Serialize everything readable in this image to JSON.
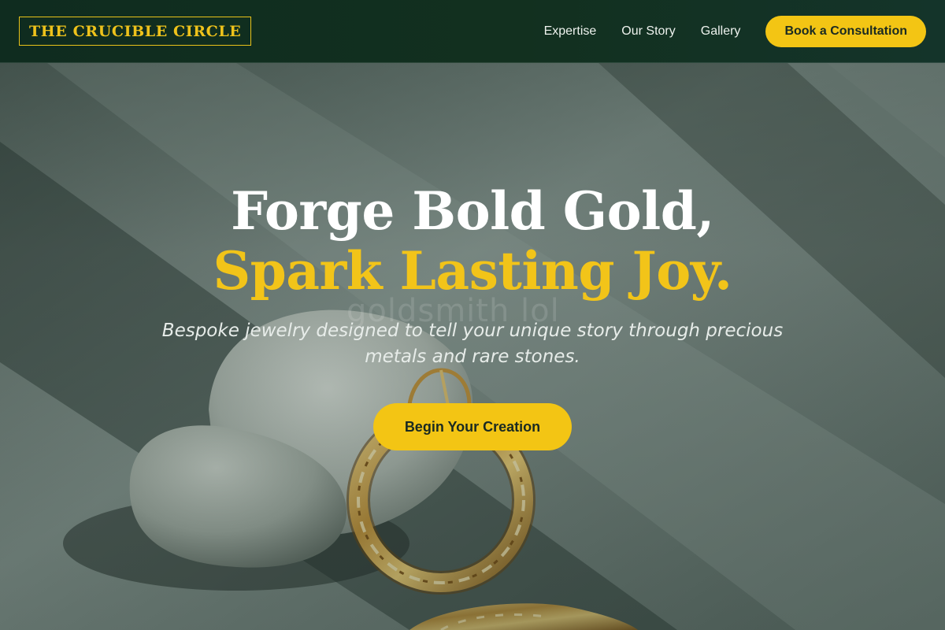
{
  "brand": {
    "name": "THE CRUCIBLE CIRCLE",
    "accent_color": "#f3c514",
    "header_color": "#0f2c1f"
  },
  "nav": {
    "links": [
      "Expertise",
      "Our Story",
      "Gallery"
    ],
    "cta_label": "Book a Consultation"
  },
  "hero": {
    "headline_line1": "Forge Bold Gold,",
    "headline_line2": "Spark Lasting Joy.",
    "subtext": "Bespoke jewelry designed to tell your unique story through precious metals and rare stones.",
    "button_label": "Begin Your Creation",
    "watermark_text": "goldsmith lol",
    "background_image": "gold-twisted-hoop-earring-on-white-stones-photo"
  }
}
